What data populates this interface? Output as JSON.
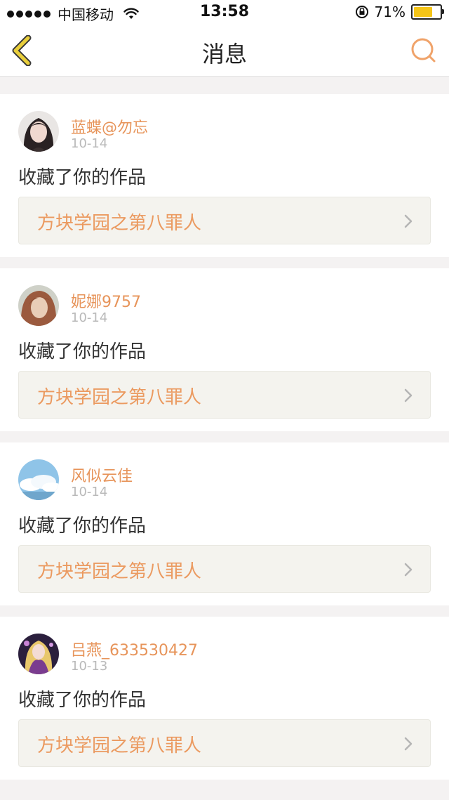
{
  "status_bar": {
    "carrier": "中国移动",
    "time": "13:58",
    "battery": "71%",
    "battery_level": 0.71
  },
  "header": {
    "title": "消息"
  },
  "colors": {
    "accent": "#e7945a",
    "back_icon": "#e9cf3b",
    "search_icon": "#f0a36a"
  },
  "messages": [
    {
      "username": "蓝蝶@勿忘",
      "date": "10-14",
      "action": "收藏了你的作品",
      "work": "方块学园之第八罪人",
      "avatar_icon": "avatar-girl-portrait"
    },
    {
      "username": "妮娜9757",
      "date": "10-14",
      "action": "收藏了你的作品",
      "work": "方块学园之第八罪人",
      "avatar_icon": "avatar-auburn-hair"
    },
    {
      "username": "风似云佳",
      "date": "10-14",
      "action": "收藏了你的作品",
      "work": "方块学园之第八罪人",
      "avatar_icon": "avatar-blue-sky-clouds"
    },
    {
      "username": "吕燕_633530427",
      "date": "10-13",
      "action": "收藏了你的作品",
      "work": "方块学园之第八罪人",
      "avatar_icon": "avatar-anime-character"
    }
  ]
}
